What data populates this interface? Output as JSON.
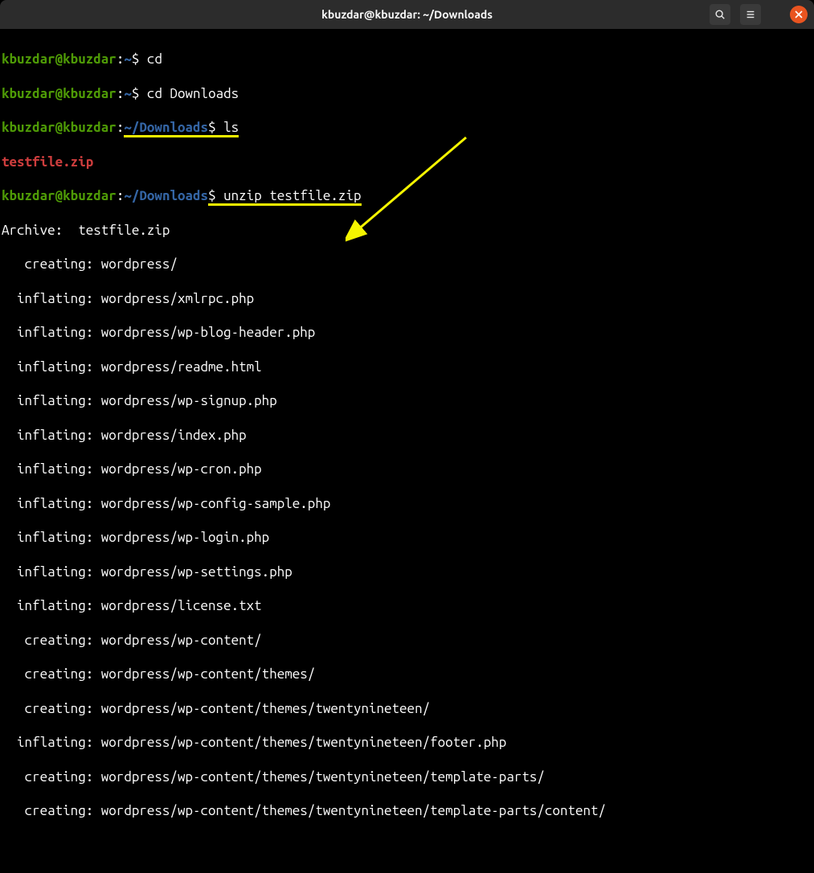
{
  "window": {
    "title": "kbuzdar@kbuzdar: ~/Downloads"
  },
  "prompt": {
    "user_host": "kbuzdar@kbuzdar",
    "path_home": "~",
    "path_downloads": "~/Downloads"
  },
  "commands": {
    "cd": "cd",
    "cd_downloads": "cd Downloads",
    "ls": "ls",
    "unzip": "unzip testfile.zip"
  },
  "ls_output": {
    "file1": "testfile.zip"
  },
  "unzip_output": {
    "archive_label": "Archive:  testfile.zip",
    "lines": [
      "   creating: wordpress/",
      "  inflating: wordpress/xmlrpc.php",
      "  inflating: wordpress/wp-blog-header.php",
      "  inflating: wordpress/readme.html",
      "  inflating: wordpress/wp-signup.php",
      "  inflating: wordpress/index.php",
      "  inflating: wordpress/wp-cron.php",
      "  inflating: wordpress/wp-config-sample.php",
      "  inflating: wordpress/wp-login.php",
      "  inflating: wordpress/wp-settings.php",
      "  inflating: wordpress/license.txt",
      "   creating: wordpress/wp-content/",
      "   creating: wordpress/wp-content/themes/",
      "   creating: wordpress/wp-content/themes/twentynineteen/",
      "  inflating: wordpress/wp-content/themes/twentynineteen/footer.php",
      "   creating: wordpress/wp-content/themes/twentynineteen/template-parts/",
      "   creating: wordpress/wp-content/themes/twentynineteen/template-parts/content/"
    ]
  }
}
